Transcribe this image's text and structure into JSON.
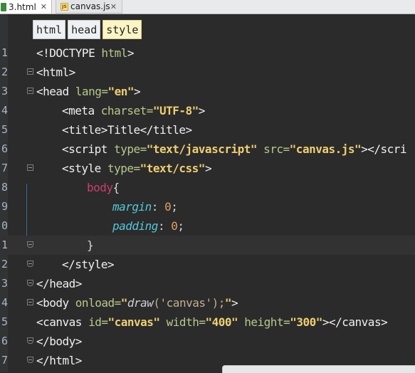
{
  "tabs": [
    {
      "label": "3.html",
      "icon": "html-file-icon",
      "active": true
    },
    {
      "label": "canvas.js",
      "icon": "js-file-icon",
      "active": false
    }
  ],
  "close_glyph": "✕",
  "breadcrumb": [
    "html",
    "head",
    "style"
  ],
  "line_numbers": [
    "1",
    "2",
    "3",
    "4",
    "5",
    "6",
    "7",
    "8",
    "9",
    "0",
    "1",
    "2",
    "3",
    "4",
    "5",
    "6",
    "7"
  ],
  "code": {
    "l1_doctype": "<!DOCTYPE ",
    "l1_html": "html",
    "l1_close": ">",
    "l2": "<html>",
    "l3_open": "<head ",
    "l3_attr": "lang=",
    "l3_val": "\"en\"",
    "l3_close": ">",
    "l4_open": "<meta ",
    "l4_attr": "charset=",
    "l4_val": "\"UTF-8\"",
    "l4_close": ">",
    "l5": "<title>Title</title>",
    "l6_open": "<script ",
    "l6_attr1": "type=",
    "l6_val1": "\"text/javascript\"",
    "l6_attr2": " src=",
    "l6_val2": "\"canvas.js\"",
    "l6_close": "></scri",
    "l7_open": "<style ",
    "l7_attr": "type=",
    "l7_val": "\"text/css\"",
    "l7_close": ">",
    "l8_sel": "body",
    "l8_brace": "{",
    "l9_prop": "margin",
    "l9_colon": ": ",
    "l9_val": "0",
    "l9_semi": ";",
    "l10_prop": "padding",
    "l10_colon": ": ",
    "l10_val": "0",
    "l10_semi": ";",
    "l11": "}",
    "l12": "</style>",
    "l13": "</head>",
    "l14_open": "<body ",
    "l14_attr": "onload=",
    "l14_q1": "\"",
    "l14_fn": "draw",
    "l14_args": "('canvas');",
    "l14_q2": "\"",
    "l14_close": ">",
    "l15_open": "<canvas ",
    "l15_attr1": "id=",
    "l15_val1": "\"canvas\"",
    "l15_attr2": " width=",
    "l15_val2": "\"400\"",
    "l15_attr3": " height=",
    "l15_val3": "\"300\"",
    "l15_close": "></canvas>",
    "l16": "</body>",
    "l17": "</html>"
  }
}
